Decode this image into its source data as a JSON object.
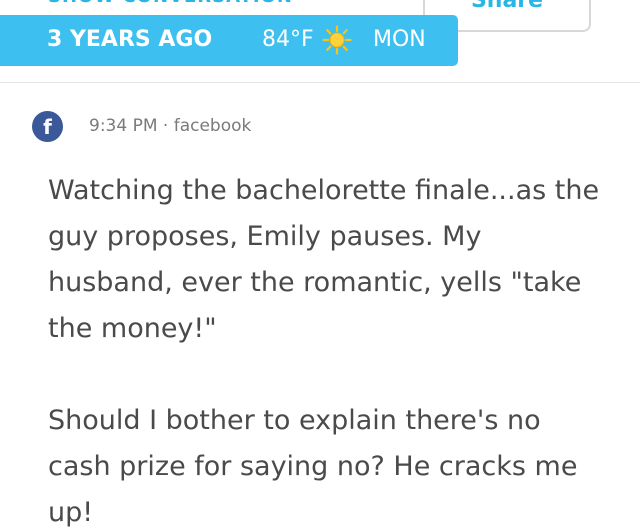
{
  "header": {
    "show_conversation_label": "SHOW CONVERSATION",
    "share_label": "Share"
  },
  "banner": {
    "years_ago": "3 YEARS AGO",
    "temperature": "84°F",
    "weather_icon": "sun-icon",
    "weekday": "MON",
    "color": "#3dbff0"
  },
  "post": {
    "source_icon": "facebook-icon",
    "source_icon_glyph": "f",
    "time": "9:34 PM",
    "separator": "·",
    "source": "facebook",
    "paragraphs": [
      "Watching the bachelorette finale...as the guy proposes, Emily pauses. My husband, ever the romantic, yells \"take the money!\"",
      "Should I bother to explain there's no cash prize for saying no? He cracks me up!"
    ]
  },
  "colors": {
    "accent": "#3dbff0",
    "facebook": "#3b5998",
    "text": "#4a4a4a",
    "meta": "#7a7a7a"
  }
}
